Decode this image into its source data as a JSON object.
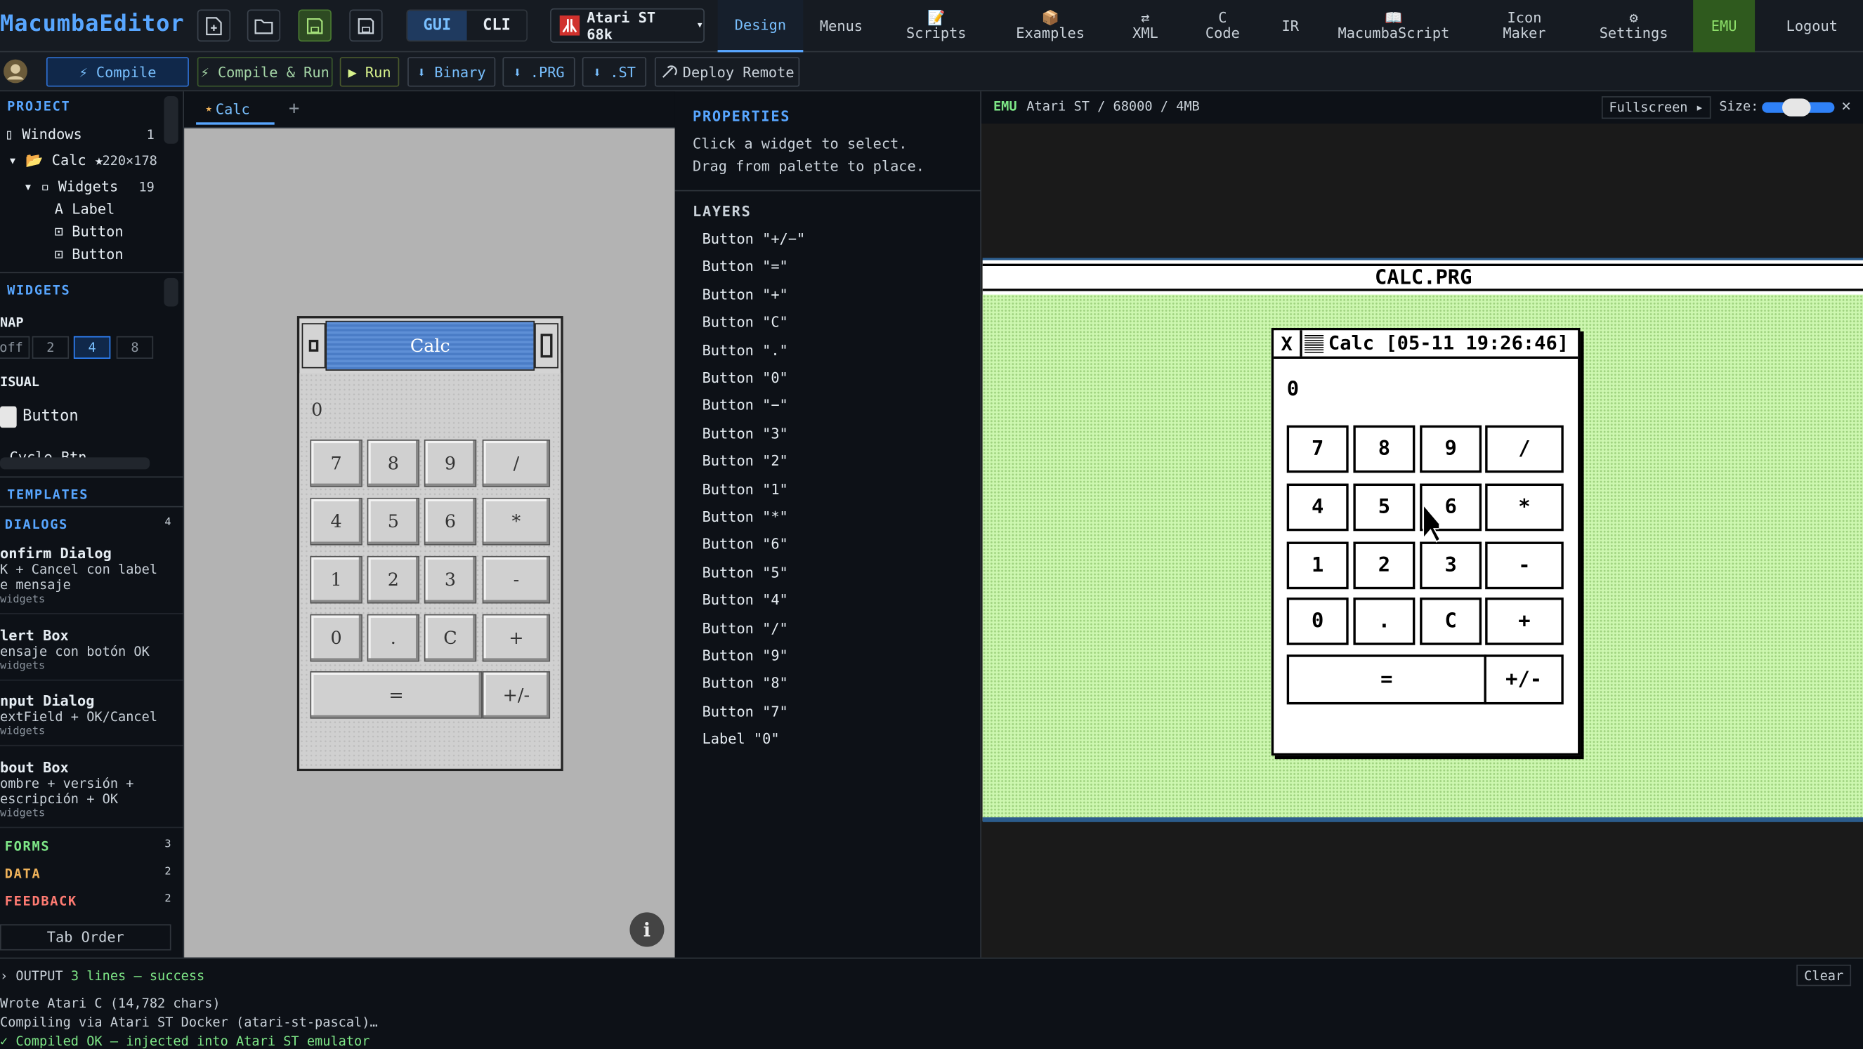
{
  "brand": "MacumbaEditor",
  "mode": {
    "gui": "GUI",
    "cli": "CLI"
  },
  "target": {
    "label": "Atari ST 68k",
    "caret": "▾"
  },
  "nav": [
    {
      "icon": "",
      "l1": "Design",
      "l2": ""
    },
    {
      "icon": "",
      "l1": "Menus",
      "l2": ""
    },
    {
      "icon": "📝",
      "l1": "Scripts",
      "l2": ""
    },
    {
      "icon": "📦",
      "l1": "Examples",
      "l2": ""
    },
    {
      "icon": "⇄",
      "l1": "XML",
      "l2": ""
    },
    {
      "icon": "",
      "l1": "C",
      "l2": "Code"
    },
    {
      "icon": "",
      "l1": "IR",
      "l2": ""
    },
    {
      "icon": "📖",
      "l1": "MacumbaScript",
      "l2": ""
    },
    {
      "icon": "",
      "l1": "Icon",
      "l2": "Maker"
    },
    {
      "icon": "⚙",
      "l1": "Settings",
      "l2": ""
    },
    {
      "icon": "",
      "l1": "EMU",
      "l2": ""
    },
    {
      "icon": "",
      "l1": "Logout",
      "l2": ""
    }
  ],
  "toolbar": {
    "compile": "⚡ Compile",
    "compile_run": "⚡ Compile & Run",
    "run": "▶ Run",
    "binary": "⬇ Binary",
    "prg": "⬇ .PRG",
    "st": "⬇ .ST",
    "deploy": "Deploy Remote"
  },
  "project": {
    "heading": "PROJECT",
    "windows": "Windows",
    "windows_count": "1",
    "calc": "Calc ★",
    "calc_size": "220×178",
    "widgets": "Widgets",
    "widgets_count": "19",
    "items": [
      "A Label",
      "⊡ Button",
      "⊡ Button"
    ]
  },
  "widgets": {
    "heading": "WIDGETS",
    "snap": "NAP",
    "snap_options": [
      "off",
      "2",
      "4",
      "8"
    ],
    "visual": "ISUAL",
    "button": "Button",
    "cycle": "Cycle Btn"
  },
  "templates": {
    "heading": "TEMPLATES",
    "dialogs": "DIALOGS",
    "dialogs_count": "4"
  },
  "tpl_items": [
    {
      "title": "onfirm Dialog",
      "d1": "K + Cancel con label",
      "d2": "e mensaje",
      "w": "widgets"
    },
    {
      "title": "lert Box",
      "d1": "ensaje con botón OK",
      "d2": "",
      "w": "widgets"
    },
    {
      "title": "nput Dialog",
      "d1": "extField + OK/Cancel",
      "d2": "",
      "w": "widgets"
    },
    {
      "title": "bout Box",
      "d1": "ombre + versión +",
      "d2": "escripción + OK",
      "w": "widgets"
    }
  ],
  "categories": [
    {
      "name": "FORMS",
      "count": "3",
      "color": "#7ee787"
    },
    {
      "name": "DATA",
      "count": "2",
      "color": "#f0b35a"
    },
    {
      "name": "FEEDBACK",
      "count": "2",
      "color": "#ff7b72"
    }
  ],
  "tab_order": "Tab Order",
  "editor": {
    "tab": "Calc",
    "tab_star": "★",
    "add": "+",
    "info": "i"
  },
  "gui_calc": {
    "title": "Calc",
    "display": "0",
    "rows": [
      [
        "7",
        "8",
        "9",
        "/"
      ],
      [
        "4",
        "5",
        "6",
        "*"
      ],
      [
        "1",
        "2",
        "3",
        "-"
      ],
      [
        "0",
        ".",
        "C",
        "+"
      ]
    ],
    "eq": "=",
    "pm": "+/-"
  },
  "properties": {
    "heading": "PROPERTIES",
    "hint1": "Click a widget to select.",
    "hint2": "Drag from palette to place."
  },
  "layers": {
    "heading": "LAYERS",
    "items": [
      "Button \"+/−\"",
      "Button \"=\"",
      "Button \"+\"",
      "Button \"C\"",
      "Button \".\"",
      "Button \"0\"",
      "Button \"−\"",
      "Button \"3\"",
      "Button \"2\"",
      "Button \"1\"",
      "Button \"*\"",
      "Button \"6\"",
      "Button \"5\"",
      "Button \"4\"",
      "Button \"/\"",
      "Button \"9\"",
      "Button \"8\"",
      "Button \"7\"",
      "Label \"0\""
    ]
  },
  "emu": {
    "tag": "EMU",
    "info": "Atari ST / 68000 / 4MB",
    "fullscreen": "Fullscreen ▸",
    "size": "Size:",
    "close": "✕",
    "menubar": "CALC.PRG",
    "win_title": "Calc [05-11 19:26:46]",
    "closer": "X",
    "display": "0",
    "rows": [
      [
        "7",
        "8",
        "9",
        "/"
      ],
      [
        "4",
        "5",
        "6",
        "*"
      ],
      [
        "1",
        "2",
        "3",
        "-"
      ],
      [
        "0",
        ".",
        "C",
        "+"
      ]
    ],
    "eq": "=",
    "pm": "+/-"
  },
  "output": {
    "label": "OUTPUT",
    "status": "3 lines — success",
    "clear": "Clear",
    "lines": [
      "Wrote Atari C (14,782 chars)",
      "Compiling via Atari ST Docker (atari-st-pascal)…",
      "✓ Compiled OK — injected into Atari ST emulator"
    ]
  },
  "colors": {
    "accent": "#58a6ff",
    "success": "#7ee787",
    "emu_green": "#2f5a1e",
    "st_desktop": "#cdf7b0"
  }
}
